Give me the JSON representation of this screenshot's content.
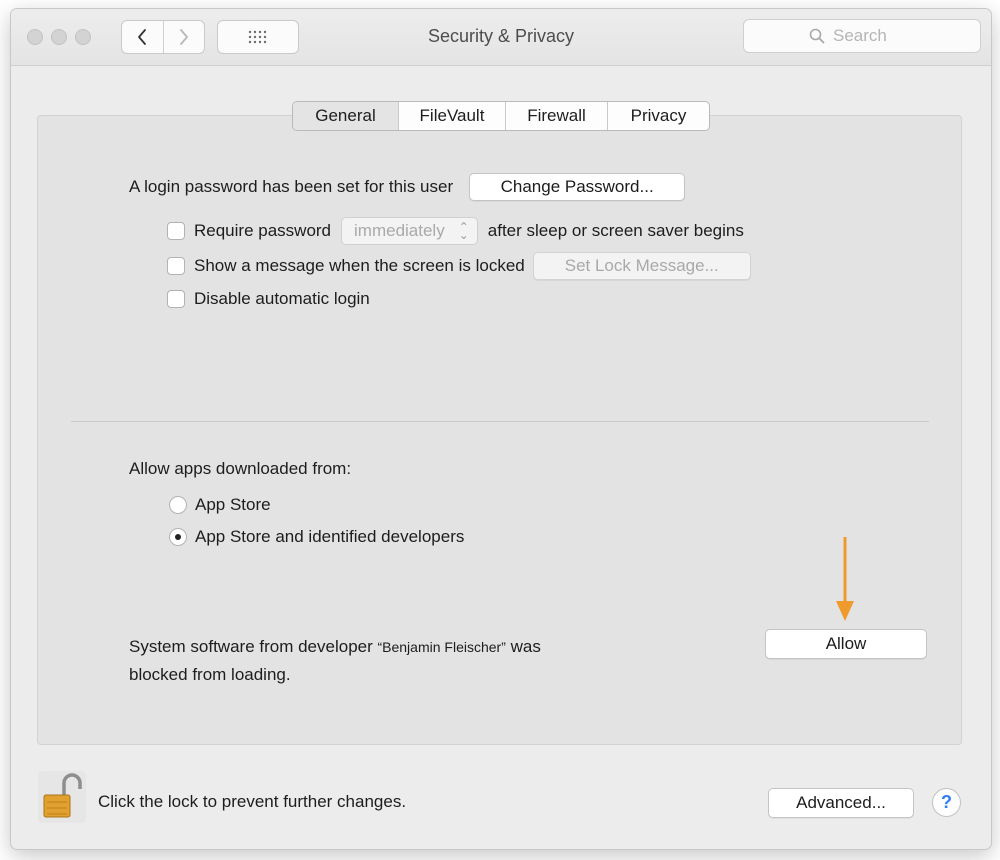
{
  "window": {
    "title": "Security & Privacy"
  },
  "toolbar": {
    "search_placeholder": "Search"
  },
  "tabs": [
    {
      "label": "General",
      "active": true
    },
    {
      "label": "FileVault",
      "active": false
    },
    {
      "label": "Firewall",
      "active": false
    },
    {
      "label": "Privacy",
      "active": false
    }
  ],
  "general": {
    "login_text": "A login password has been set for this user",
    "change_password_label": "Change Password...",
    "require_password": {
      "label": "Require password",
      "checked": false,
      "popup_value": "immediately",
      "suffix": "after sleep or screen saver begins"
    },
    "show_message": {
      "label": "Show a message when the screen is locked",
      "checked": false,
      "button_label": "Set Lock Message..."
    },
    "disable_auto_login": {
      "label": "Disable automatic login",
      "checked": false
    }
  },
  "downloads": {
    "heading": "Allow apps downloaded from:",
    "options": [
      {
        "label": "App Store",
        "selected": false
      },
      {
        "label": "App Store and identified developers",
        "selected": true
      }
    ]
  },
  "blocked": {
    "line1_prefix": "System software from developer ",
    "developer": "“Benjamin Fleischer”",
    "line1_suffix": " was",
    "line2": "blocked from loading.",
    "allow_label": "Allow",
    "arrow_color": "#ef9a2c"
  },
  "footer": {
    "lock_text": "Click the lock to prevent further changes.",
    "advanced_label": "Advanced...",
    "help_label": "?",
    "lock_icon": "unlocked-padlock-icon"
  }
}
